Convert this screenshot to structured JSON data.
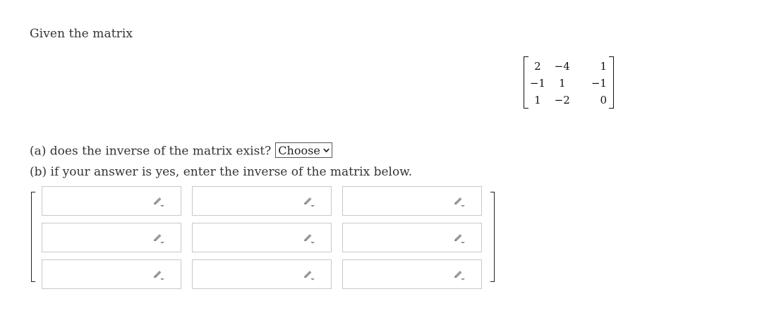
{
  "intro_text": "Given the matrix",
  "given_matrix": {
    "rows": [
      [
        "2",
        "−4",
        "1"
      ],
      [
        "−1",
        "1",
        "−1"
      ],
      [
        "1",
        "−2",
        "0"
      ]
    ]
  },
  "question_a": {
    "text": "(a) does the inverse of the matrix exist?",
    "select_value": "Choose"
  },
  "question_b": {
    "text": "(b) if your answer is yes, enter the inverse of the matrix below."
  },
  "answer_matrix": {
    "rows": 3,
    "cols": 3,
    "cells": [
      [
        "",
        "",
        ""
      ],
      [
        "",
        "",
        ""
      ],
      [
        "",
        "",
        ""
      ]
    ],
    "cell_icon": "pencil-icon"
  }
}
